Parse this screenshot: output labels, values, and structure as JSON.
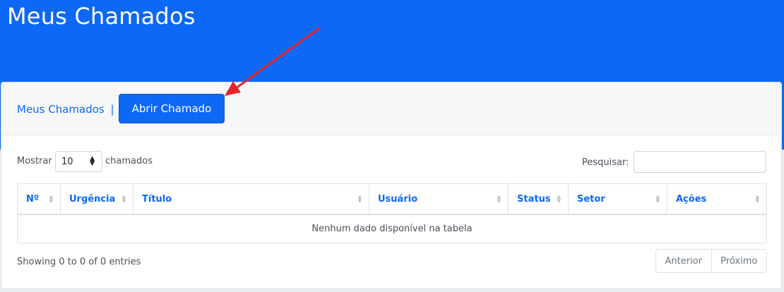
{
  "page": {
    "title": "Meus Chamados"
  },
  "header": {
    "breadcrumb": "Meus Chamados",
    "separator": "|",
    "open_button": "Abrir Chamado"
  },
  "controls": {
    "show_label": "Mostrar",
    "page_size": "10",
    "page_size_suffix": "chamados",
    "search_label": "Pesquisar:",
    "search_value": ""
  },
  "table": {
    "columns": [
      "Nº",
      "Urgência",
      "Título",
      "Usuário",
      "Status",
      "Setor",
      "Ações"
    ],
    "empty_message": "Nenhum dado disponível na tabela"
  },
  "footer": {
    "info": "Showing 0 to 0 of 0 entries",
    "prev": "Anterior",
    "next": "Próximo"
  },
  "colors": {
    "brand": "#0d68f5",
    "annotation_arrow": "#e3262b"
  },
  "icons": {
    "sort": "sort-icon",
    "select_arrows": "select-arrows-icon"
  }
}
